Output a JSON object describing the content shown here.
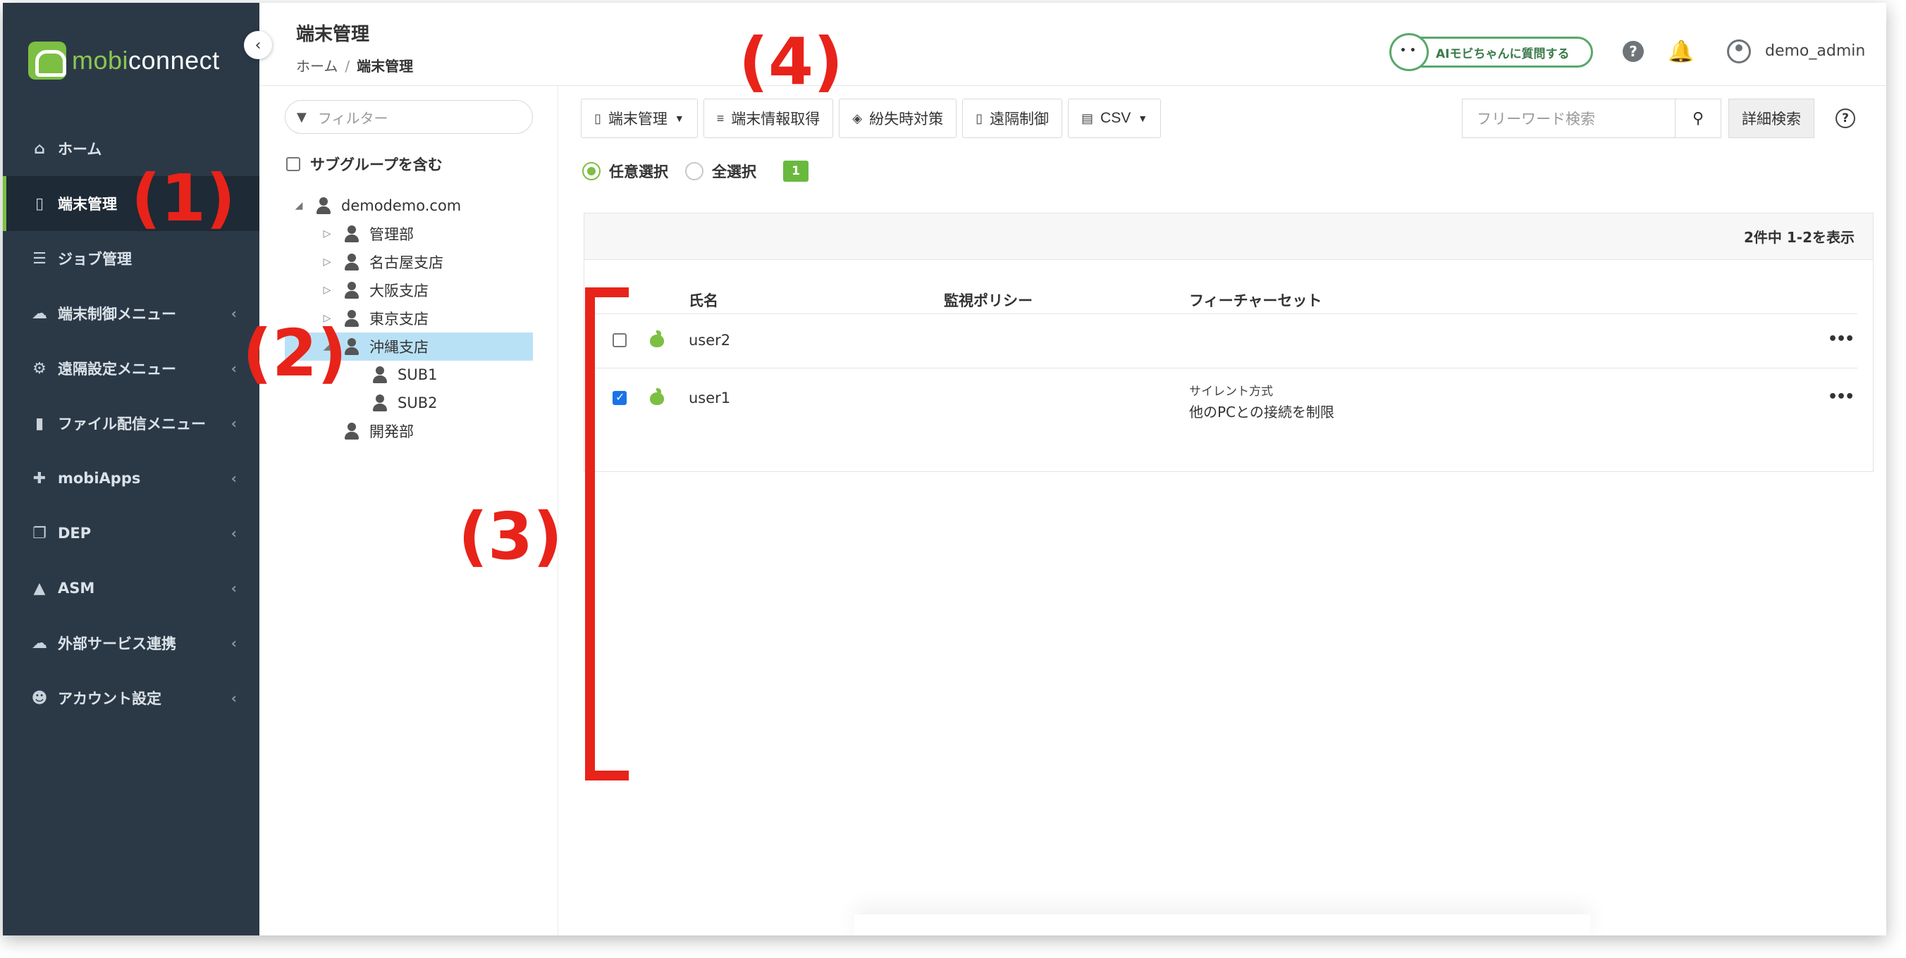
{
  "sidebar": {
    "logo": "mobiconnect",
    "items": [
      {
        "label": "ホーム",
        "icon": "home-icon",
        "active": false,
        "has_submenu": false
      },
      {
        "label": "端末管理",
        "icon": "device-icon",
        "active": true,
        "has_submenu": false
      },
      {
        "label": "ジョブ管理",
        "icon": "server-icon",
        "active": false,
        "has_submenu": false
      },
      {
        "label": "端末制御メニュー",
        "icon": "cloud-icon",
        "active": false,
        "has_submenu": true
      },
      {
        "label": "遠隔設定メニュー",
        "icon": "cogs-icon",
        "active": false,
        "has_submenu": true
      },
      {
        "label": "ファイル配信メニュー",
        "icon": "file-icon",
        "active": false,
        "has_submenu": true
      },
      {
        "label": "mobiApps",
        "icon": "puzzle-icon",
        "active": false,
        "has_submenu": true
      },
      {
        "label": "DEP",
        "icon": "copy-icon",
        "active": false,
        "has_submenu": true
      },
      {
        "label": "ASM",
        "icon": "graduation-cap-icon",
        "active": false,
        "has_submenu": true
      },
      {
        "label": "外部サービス連携",
        "icon": "cloud-service-icon",
        "active": false,
        "has_submenu": true
      },
      {
        "label": "アカウント設定",
        "icon": "users-icon",
        "active": false,
        "has_submenu": true
      }
    ]
  },
  "header": {
    "title": "端末管理",
    "breadcrumb": {
      "home": "ホーム",
      "sep": "/",
      "current": "端末管理"
    },
    "ai_button": "AIモビちゃんに質問する",
    "user": "demo_admin"
  },
  "tree": {
    "filter_placeholder": "フィルター",
    "include_subgroups": "サブグループを含む",
    "nodes": [
      {
        "label": "demodemo.com",
        "toggle": "◢"
      },
      {
        "label": "管理部",
        "toggle": "▷"
      },
      {
        "label": "名古屋支店",
        "toggle": "▷"
      },
      {
        "label": "大阪支店",
        "toggle": "▷"
      },
      {
        "label": "東京支店",
        "toggle": "▷"
      },
      {
        "label": "沖縄支店",
        "toggle": "◢",
        "selected": true
      },
      {
        "label": "SUB1",
        "toggle": ""
      },
      {
        "label": "SUB2",
        "toggle": ""
      },
      {
        "label": "開発部",
        "toggle": ""
      }
    ]
  },
  "toolbar": {
    "buttons": [
      {
        "label": "端末管理",
        "icon": "mobile-icon",
        "dropdown": true
      },
      {
        "label": "端末情報取得",
        "icon": "database-icon",
        "dropdown": false
      },
      {
        "label": "紛失時対策",
        "icon": "shield-icon",
        "dropdown": false
      },
      {
        "label": "遠隔制御",
        "icon": "remote-icon",
        "dropdown": false
      },
      {
        "label": "CSV",
        "icon": "csv-icon",
        "dropdown": true
      }
    ],
    "search_placeholder": "フリーワード検索",
    "advanced_search": "詳細検索"
  },
  "selection": {
    "option_any": "任意選択",
    "option_all": "全選択",
    "count": "1"
  },
  "table": {
    "summary": "2件中 1-2を表示",
    "columns": [
      "氏名",
      "監視ポリシー",
      "フィーチャーセット"
    ],
    "rows": [
      {
        "name": "user2",
        "policy": "",
        "featureset_mode": "",
        "featureset_desc": "",
        "checked": false,
        "os": "apple"
      },
      {
        "name": "user1",
        "policy": "",
        "featureset_mode": "サイレント方式",
        "featureset_desc": "他のPCとの接続を制限",
        "checked": true,
        "os": "apple"
      }
    ],
    "row_menu": "•••"
  },
  "annotations": {
    "a1": "(1)",
    "a2": "(2)",
    "a3": "(3)",
    "a4": "(4)"
  },
  "colors": {
    "sidebar_bg": "#2b3947",
    "accent_green": "#7cbf43",
    "tree_selected": "#b9e1f5",
    "annotation_red": "#e8231a"
  }
}
